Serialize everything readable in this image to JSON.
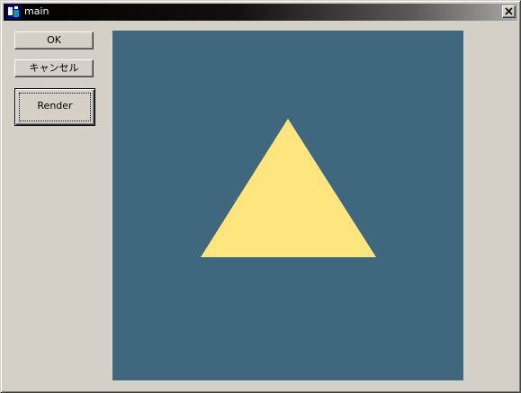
{
  "window": {
    "title": "main",
    "icon": "app-icon",
    "close_icon": "close-icon"
  },
  "buttons": {
    "ok_label": "OK",
    "cancel_label": "キャンセル",
    "render_label": "Render"
  },
  "colors": {
    "face": "#d4d0c8",
    "canvas_background": "#3f677e",
    "triangle_fill": "#ffe57e"
  },
  "canvas": {
    "shape": "triangle"
  }
}
